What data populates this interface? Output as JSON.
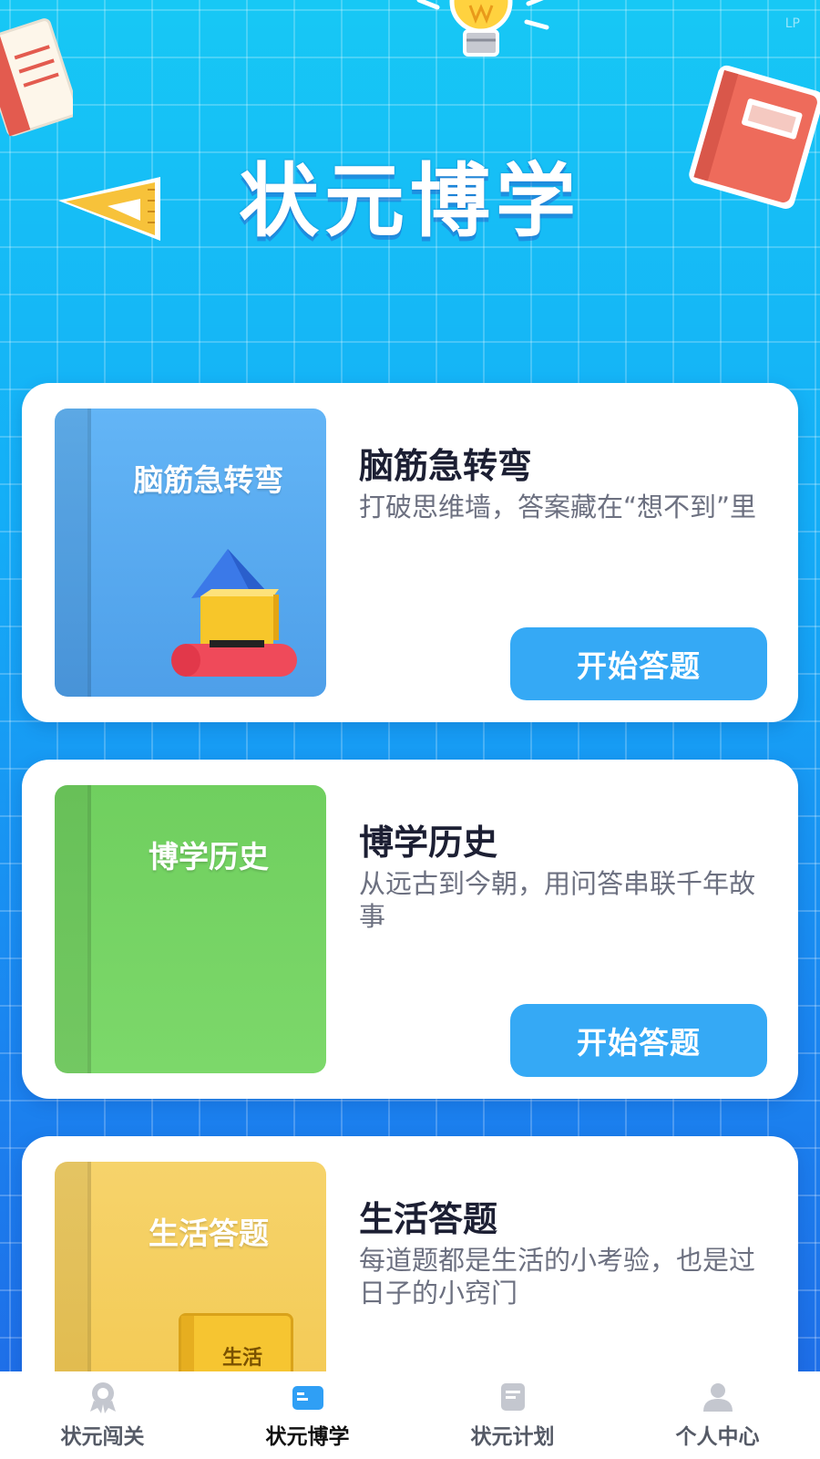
{
  "status": {
    "corner_tag": "LP"
  },
  "hero": {
    "title": "状元博学"
  },
  "cards": [
    {
      "cover_text": "脑筋急转弯",
      "title": "脑筋急转弯",
      "description": "打破思维墙，答案藏在“想不到”里",
      "button_label": "开始答题",
      "cover_color": "#5aa9f0"
    },
    {
      "cover_text": "博学历史",
      "title": "博学历史",
      "description": "从远古到今朝，用问答串联千年故事",
      "button_label": "开始答题",
      "cover_color": "#72cf62"
    },
    {
      "cover_text": "生活答题",
      "title": "生活答题",
      "description": "每道题都是生活的小考验，也是过日子的小窍门",
      "inner_book_label": "生活",
      "cover_color": "#f5cf5a"
    }
  ],
  "tabbar": {
    "items": [
      {
        "label": "状元闯关",
        "icon": "medal-icon",
        "active": false
      },
      {
        "label": "状元博学",
        "icon": "card-icon",
        "active": true
      },
      {
        "label": "状元计划",
        "icon": "document-icon",
        "active": false
      },
      {
        "label": "个人中心",
        "icon": "user-icon",
        "active": false
      }
    ]
  },
  "colors": {
    "accent": "#35a9f5",
    "tab_active": "#111111",
    "tab_inactive": "#555a66"
  }
}
